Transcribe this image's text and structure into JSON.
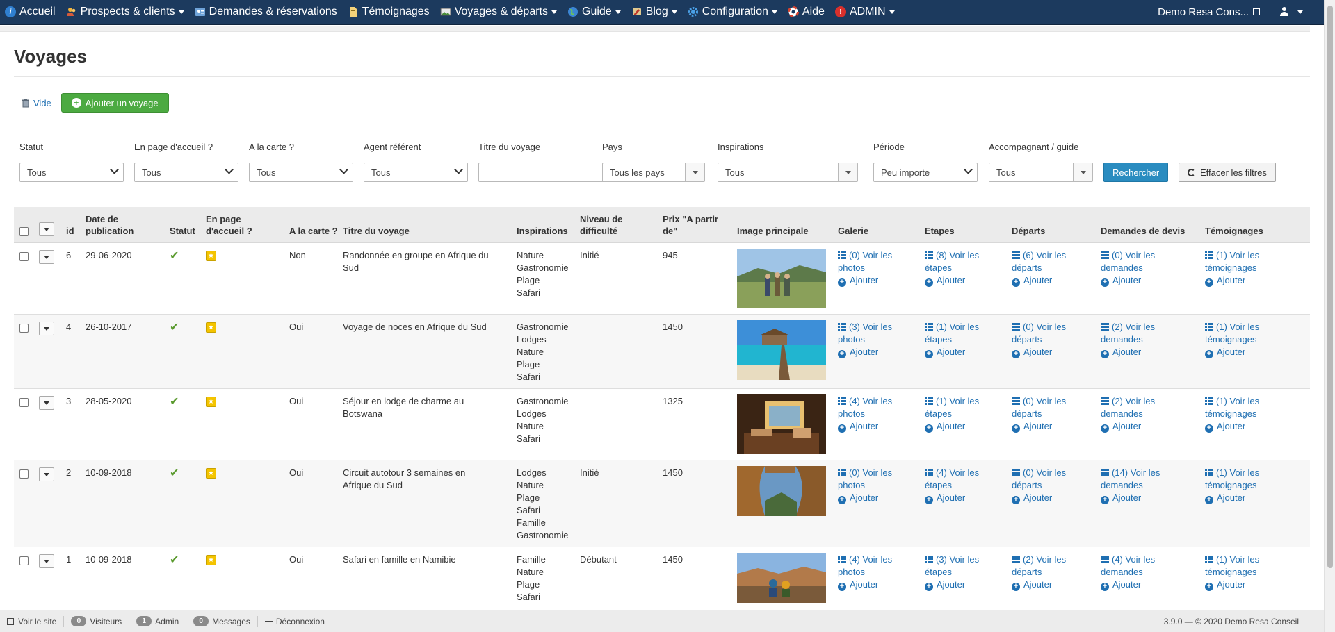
{
  "nav": {
    "items": [
      {
        "label": "Accueil",
        "icon": "info-icon",
        "caret": false
      },
      {
        "label": "Prospects & clients",
        "icon": "users-icon",
        "caret": true
      },
      {
        "label": "Demandes & réservations",
        "icon": "contact-card-icon",
        "caret": false
      },
      {
        "label": "Témoignages",
        "icon": "document-icon",
        "caret": false
      },
      {
        "label": "Voyages & départs",
        "icon": "image-card-icon",
        "caret": true
      },
      {
        "label": "Guide",
        "icon": "globe-icon",
        "caret": true
      },
      {
        "label": "Blog",
        "icon": "blog-icon",
        "caret": true
      },
      {
        "label": "Configuration",
        "icon": "gear-icon",
        "caret": true
      },
      {
        "label": "Aide",
        "icon": "lifebuoy-icon",
        "caret": false
      },
      {
        "label": "ADMIN",
        "icon": "alert-icon",
        "caret": true
      }
    ],
    "site_name": "Demo Resa Cons..."
  },
  "page": {
    "title": "Voyages"
  },
  "toolbar": {
    "empty_label": "Vide",
    "add_label": "Ajouter un voyage"
  },
  "filters": {
    "statut": {
      "label": "Statut",
      "value": "Tous"
    },
    "accueil": {
      "label": "En page d'accueil ?",
      "value": "Tous"
    },
    "carte": {
      "label": "A la carte ?",
      "value": "Tous"
    },
    "agent": {
      "label": "Agent référent",
      "value": "Tous"
    },
    "titre": {
      "label": "Titre du voyage",
      "value": ""
    },
    "pays": {
      "label": "Pays",
      "value": "Tous les pays"
    },
    "inspirations": {
      "label": "Inspirations",
      "value": "Tous"
    },
    "periode": {
      "label": "Période",
      "value": "Peu importe"
    },
    "guide": {
      "label": "Accompagnant / guide",
      "value": "Tous"
    },
    "search_label": "Rechercher",
    "clear_label": "Effacer les filtres"
  },
  "table": {
    "headers": {
      "id": "id",
      "date": "Date de publication",
      "statut": "Statut",
      "accueil": "En page d'accueil ?",
      "carte": "A la carte ?",
      "titre": "Titre du voyage",
      "inspirations": "Inspirations",
      "niveau": "Niveau de difficulté",
      "prix": "Prix \"A partir de\"",
      "image": "Image principale",
      "galerie": "Galerie",
      "etapes": "Etapes",
      "departs": "Départs",
      "devis": "Demandes de devis",
      "temoignages": "Témoignages"
    },
    "add_label": "Ajouter",
    "rows": [
      {
        "id": "6",
        "date": "29-06-2020",
        "carte": "Non",
        "titre": "Randonnée en groupe en Afrique du Sud",
        "inspirations": [
          "Nature",
          "Gastronomie",
          "Plage",
          "Safari"
        ],
        "niveau": "Initié",
        "prix": "945",
        "image": "hiking-group-photo",
        "galerie": "(0) Voir les photos",
        "etapes": "(8) Voir les étapes",
        "departs": "(6) Voir les départs",
        "devis": "(0) Voir les demandes",
        "temoignages": "(1) Voir les témoignages"
      },
      {
        "id": "4",
        "date": "26-10-2017",
        "carte": "Oui",
        "titre": "Voyage de noces en Afrique du Sud",
        "inspirations": [
          "Gastronomie",
          "Lodges",
          "Nature",
          "Plage",
          "Safari"
        ],
        "niveau": "",
        "prix": "1450",
        "image": "beach-pier-photo",
        "galerie": "(3) Voir les photos",
        "etapes": "(1) Voir les étapes",
        "departs": "(0) Voir les départs",
        "devis": "(2) Voir les demandes",
        "temoignages": "(1) Voir les témoignages"
      },
      {
        "id": "3",
        "date": "28-05-2020",
        "carte": "Oui",
        "titre": "Séjour en lodge de charme au Botswana",
        "inspirations": [
          "Gastronomie",
          "Lodges",
          "Nature",
          "Safari"
        ],
        "niveau": "",
        "prix": "1325",
        "image": "lodge-interior-photo",
        "galerie": "(4) Voir les photos",
        "etapes": "(1) Voir les étapes",
        "departs": "(0) Voir les départs",
        "devis": "(2) Voir les demandes",
        "temoignages": "(1) Voir les témoignages"
      },
      {
        "id": "2",
        "date": "10-09-2018",
        "carte": "Oui",
        "titre": "Circuit autotour 3 semaines en Afrique du Sud",
        "inspirations": [
          "Lodges",
          "Nature",
          "Plage",
          "Safari",
          "Famille",
          "Gastronomie"
        ],
        "niveau": "Initié",
        "prix": "1450",
        "image": "rock-arch-photo",
        "galerie": "(0) Voir les photos",
        "etapes": "(4) Voir les étapes",
        "departs": "(0) Voir les départs",
        "devis": "(14) Voir les demandes",
        "temoignages": "(1) Voir les témoignages"
      },
      {
        "id": "1",
        "date": "10-09-2018",
        "carte": "Oui",
        "titre": "Safari en famille en Namibie",
        "inspirations": [
          "Famille",
          "Nature",
          "Plage",
          "Safari"
        ],
        "niveau": "Débutant",
        "prix": "1450",
        "image": "canyon-couple-photo",
        "galerie": "(4) Voir les photos",
        "etapes": "(3) Voir les étapes",
        "departs": "(2) Voir les départs",
        "devis": "(4) Voir les demandes",
        "temoignages": "(1) Voir les témoignages"
      }
    ]
  },
  "footer": {
    "view_site": "Voir le site",
    "visitors_count": "0",
    "visitors_label": "Visiteurs",
    "admin_count": "1",
    "admin_label": "Admin",
    "messages_count": "0",
    "messages_label": "Messages",
    "logout": "Déconnexion",
    "version": "3.9.0 — © 2020 Demo Resa Conseil"
  },
  "colors": {
    "navbar": "#1c3a5e",
    "link": "#1f6fb2",
    "add_button": "#4caa41",
    "search_button": "#2a8cc0",
    "check": "#5a9a2e",
    "star": "#f4c400"
  }
}
